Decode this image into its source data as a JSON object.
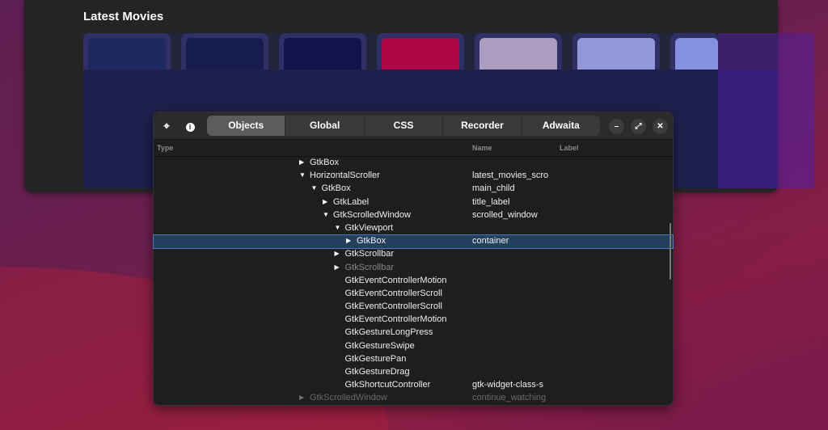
{
  "app": {
    "section_title": "Latest Movies",
    "posters": [
      {
        "color": "#1c2a52"
      },
      {
        "color": "#141a3c"
      },
      {
        "color": "#10103a"
      },
      {
        "color": "#cc0030"
      },
      {
        "color": "#c7b8c6"
      },
      {
        "color": "#aab0e6"
      },
      {
        "color": "#9aa8ee"
      }
    ]
  },
  "inspector": {
    "icons": {
      "pick": "crosshair-icon",
      "info": "info-icon"
    },
    "tabs": [
      "Objects",
      "Global",
      "CSS",
      "Recorder",
      "Adwaita"
    ],
    "active_tab": "Objects",
    "columns": {
      "type": "Type",
      "name": "Name",
      "label": "Label"
    },
    "rows": [
      {
        "depth": 0,
        "exp": "collapsed",
        "type": "GtkBox",
        "name": ""
      },
      {
        "depth": 0,
        "exp": "expanded",
        "type": "HorizontalScroller",
        "name": "latest_movies_scro"
      },
      {
        "depth": 1,
        "exp": "expanded",
        "type": "GtkBox",
        "name": "main_child"
      },
      {
        "depth": 2,
        "exp": "collapsed",
        "type": "GtkLabel",
        "name": "title_label"
      },
      {
        "depth": 2,
        "exp": "expanded",
        "type": "GtkScrolledWindow",
        "name": "scrolled_window"
      },
      {
        "depth": 3,
        "exp": "expanded",
        "type": "GtkViewport",
        "name": ""
      },
      {
        "depth": 4,
        "exp": "collapsed",
        "type": "GtkBox",
        "name": "container",
        "selected": true
      },
      {
        "depth": 3,
        "exp": "collapsed",
        "type": "GtkScrollbar",
        "name": ""
      },
      {
        "depth": 3,
        "exp": "collapsed",
        "type": "GtkScrollbar",
        "name": "",
        "dim": true
      },
      {
        "depth": 3,
        "exp": "none",
        "type": "GtkEventControllerMotion",
        "name": ""
      },
      {
        "depth": 3,
        "exp": "none",
        "type": "GtkEventControllerScroll",
        "name": ""
      },
      {
        "depth": 3,
        "exp": "none",
        "type": "GtkEventControllerScroll",
        "name": ""
      },
      {
        "depth": 3,
        "exp": "none",
        "type": "GtkEventControllerMotion",
        "name": ""
      },
      {
        "depth": 3,
        "exp": "none",
        "type": "GtkGestureLongPress",
        "name": ""
      },
      {
        "depth": 3,
        "exp": "none",
        "type": "GtkGestureSwipe",
        "name": ""
      },
      {
        "depth": 3,
        "exp": "none",
        "type": "GtkGesturePan",
        "name": ""
      },
      {
        "depth": 3,
        "exp": "none",
        "type": "GtkGestureDrag",
        "name": ""
      },
      {
        "depth": 3,
        "exp": "none",
        "type": "GtkShortcutController",
        "name": "gtk-widget-class-s"
      },
      {
        "depth": 0,
        "exp": "collapsed",
        "type": "GtkScrolledWindow",
        "name": "continue_watching",
        "faded": true
      }
    ]
  }
}
